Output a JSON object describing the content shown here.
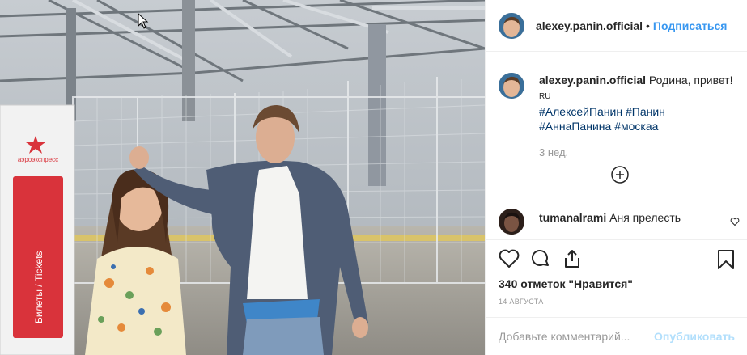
{
  "header": {
    "username": "alexey.panin.official",
    "separator": "•",
    "follow_label": "Подписаться"
  },
  "caption": {
    "username": "alexey.panin.official",
    "text": "Родина, привет!",
    "lang": "RU",
    "hashtags": [
      "#АлексейПанин",
      "#Панин",
      "#АннаПанина",
      "#москаа"
    ],
    "time_ago": "3 нед."
  },
  "comment": {
    "username": "tumanalrami",
    "text": "Аня прелесть"
  },
  "actions": {
    "like_icon": "heart-icon",
    "comment_icon": "comment-icon",
    "share_icon": "share-icon",
    "save_icon": "bookmark-icon"
  },
  "likes_text": "340 отметок \"Нравится\"",
  "date": "14 АВГУСТА",
  "add_comment": {
    "placeholder": "Добавьте комментарий...",
    "publish_label": "Опубликовать"
  },
  "photo": {
    "sign_text": "Билеты / Tickets",
    "brand_text": "аэроэкспресс"
  },
  "colors": {
    "link_blue": "#3897f0",
    "hashtag_blue": "#003569",
    "publish_disabled": "#b2dffc",
    "muted": "#999999",
    "sign_red": "#d9333b"
  }
}
